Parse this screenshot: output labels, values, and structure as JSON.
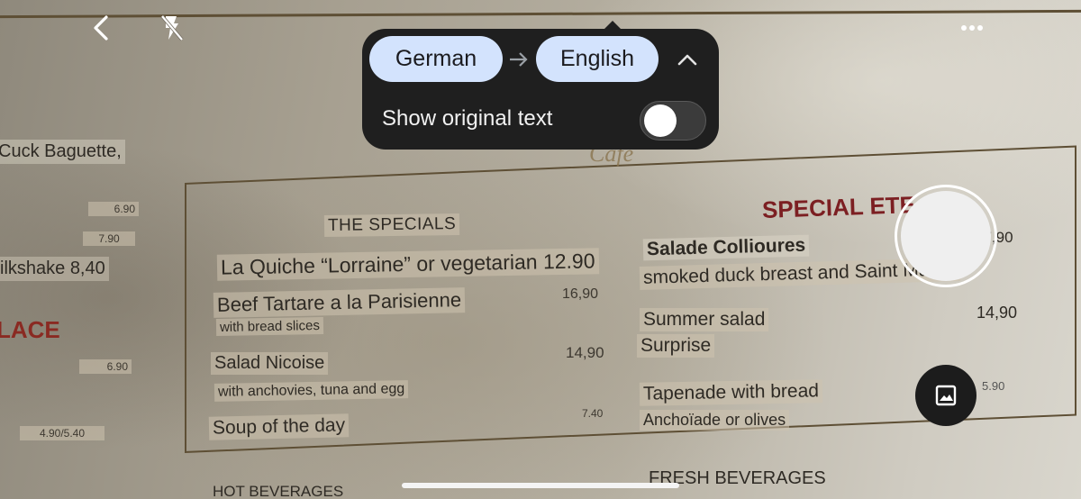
{
  "top_bar": {
    "back_icon": "chevron-left-icon",
    "flash_icon": "flash-off-icon",
    "more_icon": "more-horiz-icon"
  },
  "translate_panel": {
    "source_language": "German",
    "target_language": "English",
    "arrow_icon": "arrow-right-icon",
    "collapse_icon": "chevron-up-icon",
    "toggle_label": "Show original text",
    "toggle_on": false
  },
  "menu": {
    "left_edge": {
      "duck_baguette": "Cuck Baguette,",
      "price_a": "6.90",
      "price_b": "7.90",
      "milkshake": "ilkshake 8,40",
      "place_heading": "LACE",
      "price_c": "6.90",
      "price_d": "4.90/5.40"
    },
    "cafe_logo": "Cafe",
    "specials": {
      "heading": "THE SPECIALS",
      "quiche": "La Quiche “Lorraine” or vegetarian 12.90",
      "beef_tartare": "Beef Tartare a la Parisienne",
      "beef_tartare_price": "16,90",
      "beef_tartare_desc_1": "with bread",
      "beef_tartare_desc_2": "slices",
      "salad_nicoise": "Salad Nicoise",
      "salad_nicoise_price": "14,90",
      "salad_nicoise_desc": "with anchovies, tuna and egg",
      "soup": "Soup of the day",
      "soup_price": "7.40"
    },
    "special_ete": {
      "heading": "SPECIAL ETE",
      "salade_collioures": "Salade Collioures",
      "salade_collioures_price": "17,90",
      "salade_collioures_desc": "smoked duck breast and Saint Maure",
      "summer_salad": "Summer salad",
      "summer_salad_price": "14,90",
      "surprise": "Surprise",
      "tapenade": "Tapenade with bread",
      "tapenade_desc": "Anchoïade or olives",
      "tapenade_price": "5.90"
    },
    "hot_beverages": "HOT BEVERAGES",
    "fresh_beverages": "FRESH BEVERAGES"
  },
  "controls": {
    "shutter": "shutter-button",
    "gallery_icon": "image-icon"
  }
}
